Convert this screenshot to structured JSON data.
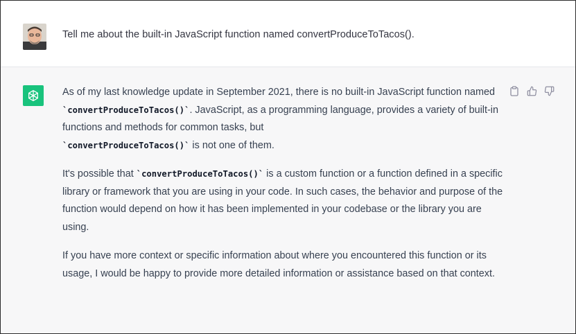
{
  "user_message": {
    "text": "Tell me about the built-in JavaScript function named convertProduceToTacos()."
  },
  "assistant_message": {
    "p1": {
      "before_code1": "As of my last knowledge update in September 2021, there is no built-in JavaScript function named ",
      "code1": "`convertProduceToTacos()`",
      "middle": ". JavaScript, as a programming language, provides a variety of built-in functions and methods for common tasks, but ",
      "code2": "`convertProduceToTacos()`",
      "after": " is not one of them."
    },
    "p2": {
      "before_code": "It's possible that ",
      "code": "`convertProduceToTacos()`",
      "after": " is a custom function or a function defined in a specific library or framework that you are using in your code. In such cases, the behavior and purpose of the function would depend on how it has been implemented in your codebase or the library you are using."
    },
    "p3": {
      "text": "If you have more context or specific information about where you encountered this function or its usage, I would be happy to provide more detailed information or assistance based on that context."
    }
  },
  "actions": {
    "copy_icon": "clipboard-icon",
    "like_icon": "thumbs-up-icon",
    "dislike_icon": "thumbs-down-icon"
  },
  "colors": {
    "assistant_bg": "#f7f7f8",
    "assistant_avatar": "#19c37d",
    "text": "#374151"
  }
}
